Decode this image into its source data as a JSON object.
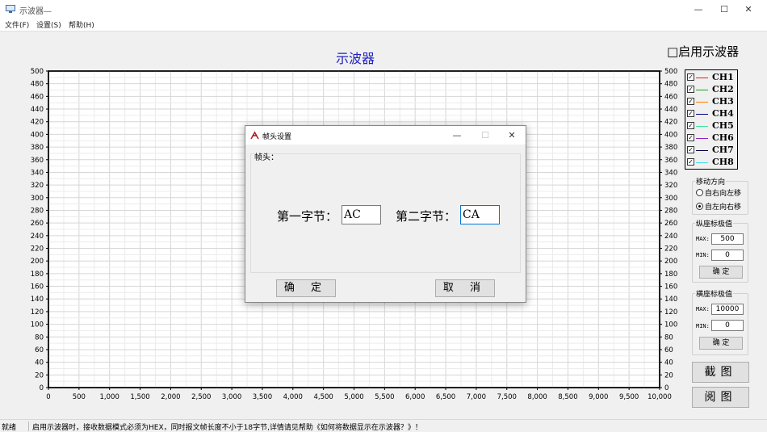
{
  "window": {
    "title": "示波器—",
    "minimize": "—",
    "maximize": "☐",
    "close": "✕"
  },
  "menu": [
    {
      "label": "文件(F)"
    },
    {
      "label": "设置(S)"
    },
    {
      "label": "帮助(H)"
    }
  ],
  "chart_data": {
    "type": "line",
    "title": "示波器",
    "xlim": [
      0,
      10000
    ],
    "ylim": [
      0,
      500
    ],
    "x_ticks": [
      "0",
      "500",
      "1,000",
      "1,500",
      "2,000",
      "2,500",
      "3,000",
      "3,500",
      "4,000",
      "4,500",
      "5,000",
      "5,500",
      "6,000",
      "6,500",
      "7,000",
      "7,500",
      "8,000",
      "8,500",
      "9,000",
      "9,500",
      "10,000"
    ],
    "y_ticks": [
      "0",
      "20",
      "40",
      "60",
      "80",
      "100",
      "120",
      "140",
      "160",
      "180",
      "200",
      "220",
      "240",
      "260",
      "280",
      "300",
      "320",
      "340",
      "360",
      "380",
      "400",
      "420",
      "440",
      "460",
      "480",
      "500"
    ],
    "grid": true,
    "series": []
  },
  "controls": {
    "enable_scope": "□启用示波器",
    "channels": [
      {
        "name": "CH1",
        "color": "#e02020",
        "checked": true
      },
      {
        "name": "CH2",
        "color": "#20a020",
        "checked": true
      },
      {
        "name": "CH3",
        "color": "#ff8000",
        "checked": true
      },
      {
        "name": "CH4",
        "color": "#000080",
        "checked": true
      },
      {
        "name": "CH5",
        "color": "#40e0a0",
        "checked": true
      },
      {
        "name": "CH6",
        "color": "#9020c0",
        "checked": true
      },
      {
        "name": "CH7",
        "color": "#000040",
        "checked": true
      },
      {
        "name": "CH8",
        "color": "#40e0f0",
        "checked": true
      }
    ],
    "check_mark": "✓",
    "direction": {
      "title": "移动方向",
      "option_rtl": "自右向左移",
      "option_ltr": "自左向右移",
      "selected": "ltr"
    },
    "y_range": {
      "title": "纵座标极值",
      "max_label": "MAX:",
      "max_value": "500",
      "min_label": "MIN:",
      "min_value": "0",
      "confirm": "确 定"
    },
    "x_range": {
      "title": "横座标极值",
      "max_label": "MAX:",
      "max_value": "10000",
      "min_label": "MIN:",
      "min_value": "0",
      "confirm": "确 定"
    },
    "screenshot_button": "截图",
    "view_button": "阅图"
  },
  "status": {
    "ready": "就绪",
    "message": "启用示波器时，接收数据模式必须为HEX，同时报文帧长度不小于18字节,详情请见帮助《如何将数据显示在示波器？》！"
  },
  "dialog": {
    "title": "帧头设置",
    "minimize": "—",
    "maximize": "☐",
    "close": "✕",
    "frame_label": "帧头：",
    "byte1_label": "第一字节：",
    "byte1_value": "AC",
    "byte2_label": "第二字节：",
    "byte2_value": "CA",
    "ok": "确 定",
    "cancel": "取 消"
  }
}
